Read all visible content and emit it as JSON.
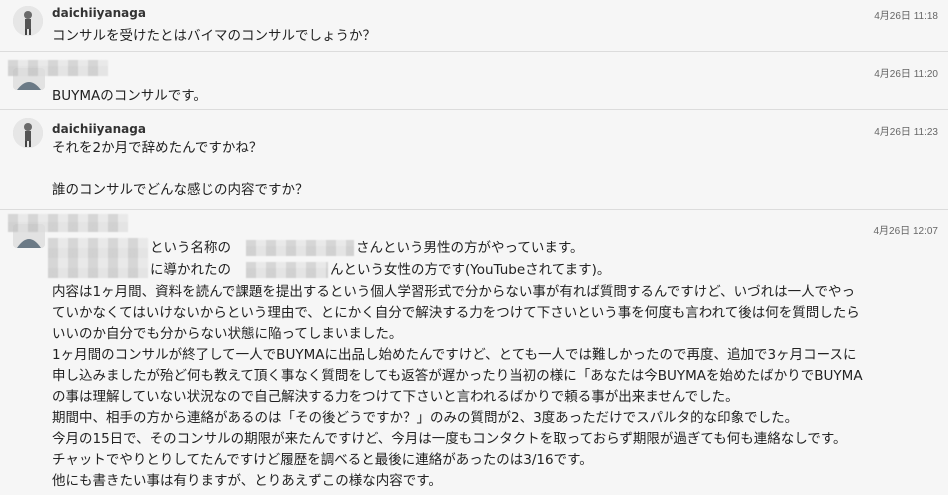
{
  "messages": [
    {
      "sender": "daichiiyanaga",
      "timestamp": "4月26日 11:18",
      "text": "コンサルを受けたとはバイマのコンサルでしょうか？"
    },
    {
      "sender": "",
      "timestamp": "4月26日 11:20",
      "text": "BUYMAのコンサルです。"
    },
    {
      "sender": "daichiiyanaga",
      "timestamp": "4月26日 11:23",
      "lines": [
        "それを2か月で辞めたんですかね？",
        "",
        "誰のコンサルでどんな感じの内容ですか？"
      ]
    },
    {
      "sender": "",
      "timestamp": "4月26日 12:07",
      "lines": [
        "という名称の",
        "さんという男性の方がやっています。",
        "に導かれたの",
        "んという女性の方です(YouTubeされてます)。",
        "内容は1ヶ月間、資料を読んで課題を提出するという個人学習形式で分からない事が有れば質問するんですけど、いづれは一人でやっ",
        "ていかなくてはいけないからという理由で、とにかく自分で解決する力をつけて下さいという事を何度も言われて後は何を質問したら",
        "いいのか自分でも分からない状態に陥ってしまいました。",
        "1ヶ月間のコンサルが終了して一人でBUYMAに出品し始めたんですけど、とても一人では難しかったので再度、追加で3ヶ月コースに",
        "申し込みましたが殆ど何も教えて頂く事なく質問をしても返答が遅かったり当初の様に「あなたは今BUYMAを始めたばかりでBUYMA",
        "の事は理解していない状況なので自己解決する力をつけて下さいと言われるばかりで頼る事が出来ませんでした。",
        "期間中、相手の方から連絡があるのは「その後どうですか？」のみの質問が2、3度あっただけでスパルタ的な印象でした。",
        "今月の15日で、そのコンサルの期限が来たんですけど、今月は一度もコンタクトを取っておらず期限が過ぎても何も連絡なしです。",
        "チャットでやりとりしてたんですけど履歴を調べると最後に連絡があったのは3/16です。",
        "他にも書きたい事は有りますが、とりあえずこの様な内容です。"
      ]
    }
  ]
}
